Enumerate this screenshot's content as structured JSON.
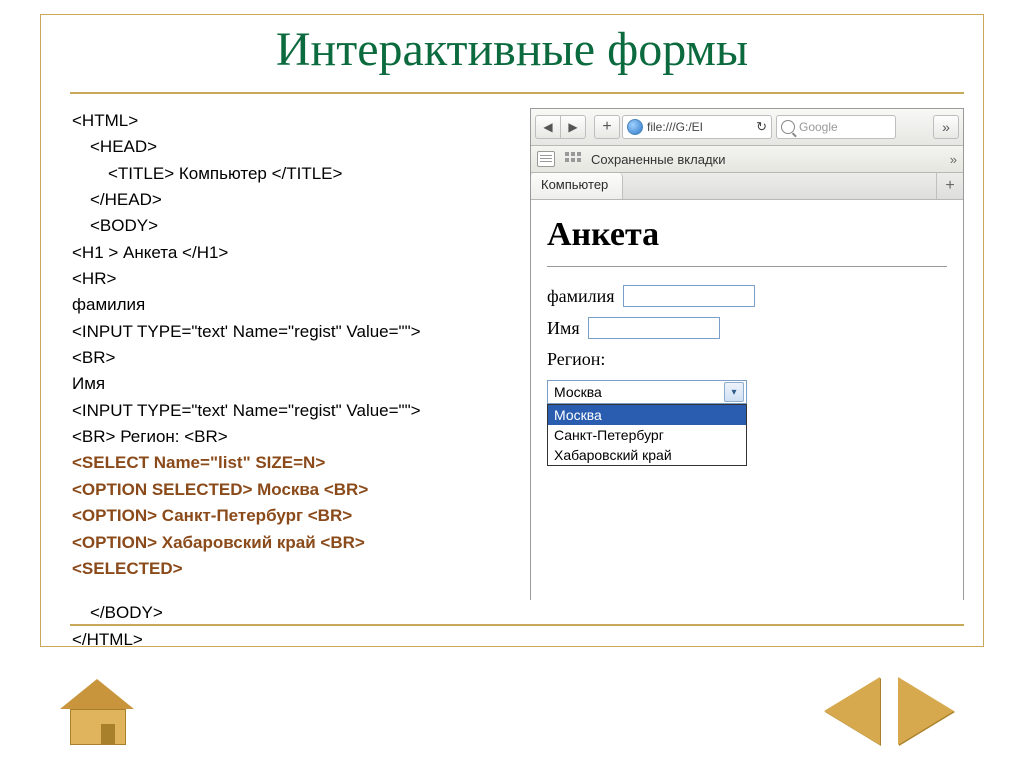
{
  "title": "Интерактивные формы",
  "code": {
    "l1": "<HTML>",
    "l2": "<HEAD>",
    "l3": "<TITLE> Компьютер </TITLE>",
    "l4": "</HEAD>",
    "l5": "<BODY>",
    "l6": "<H1 > Анкета </H1>",
    "l7": "<HR>",
    "l8": "фамилия",
    "l9": "<INPUT TYPE=\"text' Name=\"regist\" Value=\"\">",
    "l10": "<BR>",
    "l11": "Имя",
    "l12": "<INPUT TYPE=\"text' Name=\"regist\" Value=\"\">",
    "l13": "<BR> Регион: <BR>",
    "l14": "<SELECT Name=\"list\" SIZE=N>",
    "l15": "<OPTION SELECTED> Москва <BR>",
    "l16": "<OPTION> Санкт-Петербург <BR>",
    "l17": "<OPTION> Хабаровский край <BR>",
    "l18": "<SELECTED>",
    "l19": "</BODY>",
    "l20": "</HTML>"
  },
  "browser": {
    "address": "file:///G:/EI",
    "search_placeholder": "Google",
    "bookmarks_label": "Сохраненные вкладки",
    "tab_title": "Компьютер",
    "refresh_glyph": "↻"
  },
  "page": {
    "heading": "Анкета",
    "label_surname": "фамилия",
    "label_name": "Имя",
    "label_region": "Регион:",
    "select_value": "Москва",
    "options": {
      "o1": "Москва",
      "o2": "Санкт-Петербург",
      "o3": "Хабаровский край"
    }
  }
}
